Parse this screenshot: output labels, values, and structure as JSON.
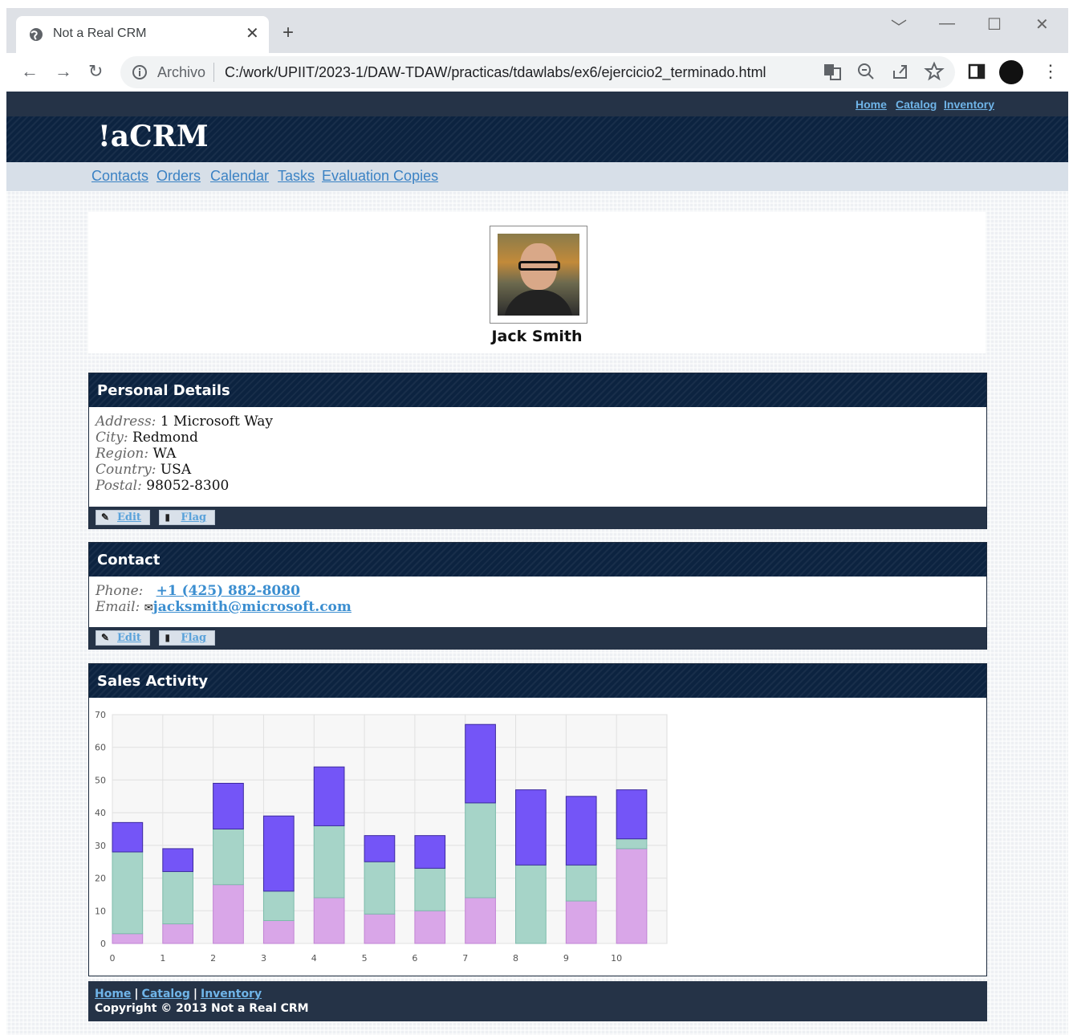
{
  "browser": {
    "tab_title": "Not a Real CRM",
    "new_tab": "+",
    "scheme_label": "Archivo",
    "url": "C:/work/UPIIT/2023-1/DAW-TDAW/practicas/tdawlabs/ex6/ejercicio2_terminado.html"
  },
  "site": {
    "logo": "!aCRM",
    "top_links": [
      "Home",
      "Catalog",
      "Inventory"
    ],
    "main_nav": [
      "Contacts",
      "Orders",
      "Calendar",
      "Tasks",
      "Evaluation Copies"
    ]
  },
  "profile": {
    "name": "Jack Smith"
  },
  "personal": {
    "title": "Personal Details",
    "address_label": "Address:",
    "address": "1 Microsoft Way",
    "city_label": "City:",
    "city": "Redmond",
    "region_label": "Region:",
    "region": "WA",
    "country_label": "Country:",
    "country": "USA",
    "postal_label": "Postal:",
    "postal": "98052-8300",
    "edit_label": "Edit",
    "flag_label": "Flag"
  },
  "contact": {
    "title": "Contact",
    "phone_label": "Phone:",
    "phone": "+1 (425) 882-8080",
    "email_label": "Email:",
    "email": "jacksmith@microsoft.com",
    "edit_label": "Edit",
    "flag_label": "Flag"
  },
  "sales": {
    "title": "Sales Activity"
  },
  "chart_data": {
    "type": "bar",
    "stacked": true,
    "x": [
      0,
      1,
      2,
      3,
      4,
      5,
      6,
      7,
      8,
      9,
      10
    ],
    "y_ticks": [
      0,
      10,
      20,
      30,
      40,
      50,
      60,
      70
    ],
    "ylim": [
      0,
      70
    ],
    "grid": true,
    "series": [
      {
        "color": "#d9a6e8",
        "values": [
          3,
          6,
          18,
          7,
          14,
          9,
          10,
          14,
          0,
          13,
          29
        ]
      },
      {
        "color": "#a6d4c8",
        "values": [
          25,
          16,
          17,
          9,
          22,
          16,
          13,
          29,
          24,
          11,
          3
        ]
      },
      {
        "color": "#7455f7",
        "values": [
          9,
          7,
          14,
          23,
          18,
          8,
          10,
          24,
          23,
          21,
          15
        ]
      }
    ]
  },
  "footer": {
    "links": [
      "Home",
      "Catalog",
      "Inventory"
    ],
    "copyright": "Copyright © 2013 Not a Real CRM"
  }
}
